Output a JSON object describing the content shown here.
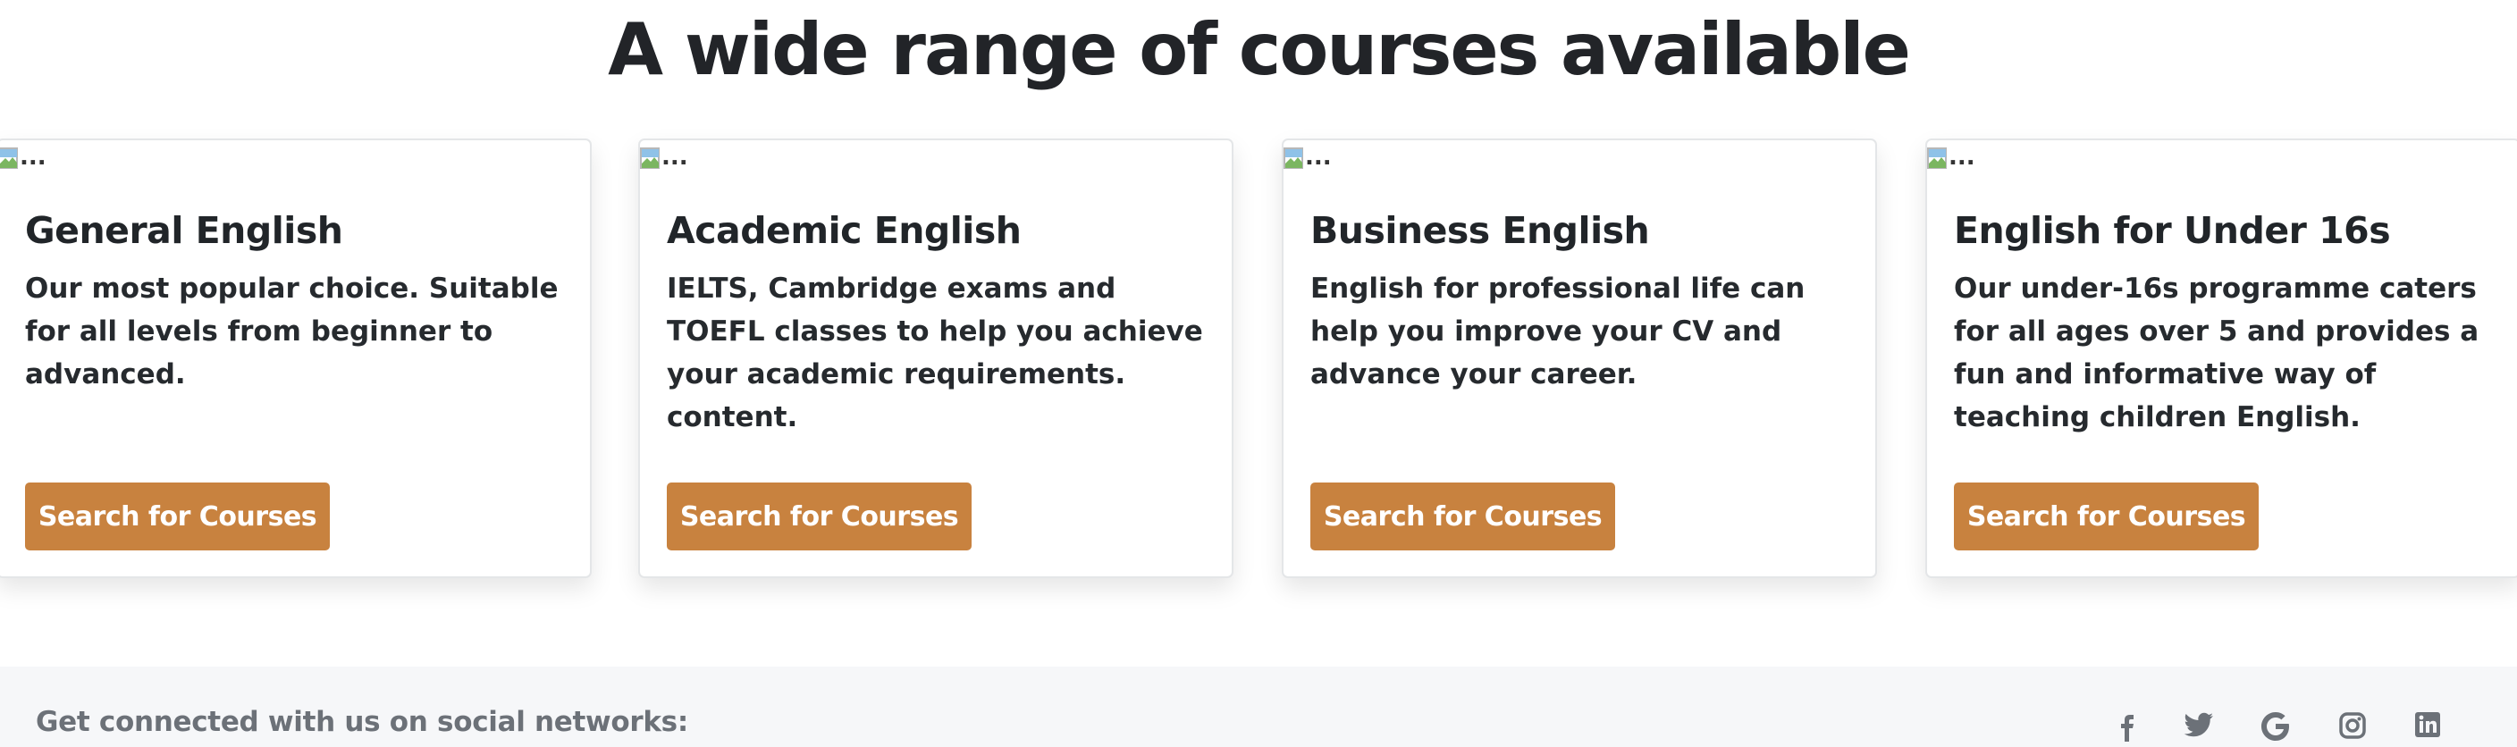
{
  "heading": "A wide range of courses available",
  "image_alt": "...",
  "cards": [
    {
      "title": "General English",
      "text": "Our most popular choice. Suitable for all levels from beginner to advanced.",
      "button": "Search for Courses"
    },
    {
      "title": "Academic English",
      "text": "IELTS, Cambridge exams and TOEFL classes to help you achieve your academic requirements. content.",
      "button": "Search for Courses"
    },
    {
      "title": "Business English",
      "text": "English for professional life can help you improve your CV and advance your career.",
      "button": "Search for Courses"
    },
    {
      "title": "English for Under 16s",
      "text": "Our under-16s programme caters for all ages over 5 and provides a fun and informative way of teaching children English.",
      "button": "Search for Courses"
    }
  ],
  "footer": {
    "social_text": "Get connected with us on social networks:",
    "icons": [
      "facebook-icon",
      "twitter-icon",
      "google-icon",
      "instagram-icon",
      "linkedin-icon"
    ]
  },
  "colors": {
    "accent": "#c8823f",
    "footer_bg": "#f6f7f9",
    "footer_text": "#6c7178"
  }
}
